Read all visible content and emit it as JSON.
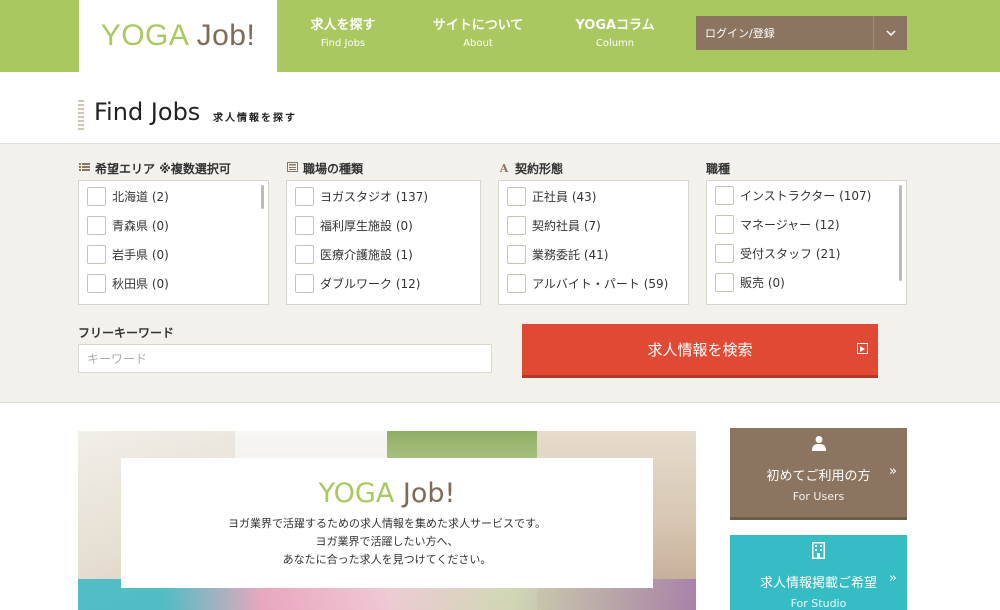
{
  "header": {
    "logo": {
      "part1": "YOGA",
      "part2": " Job!"
    },
    "nav": [
      {
        "jp": "求人を探す",
        "en": "Find Jobs"
      },
      {
        "jp": "サイトについて",
        "en": "About"
      },
      {
        "jp": "YOGAコラム",
        "en": "Column"
      }
    ],
    "login_label": "ログイン/登録"
  },
  "page_title": {
    "en": "Find Jobs",
    "jp": "求人情報を探す"
  },
  "search": {
    "groups": [
      {
        "label": "希望エリア ※複数選択可",
        "icon": "list-icon",
        "items": [
          "北海道 (2)",
          "青森県 (0)",
          "岩手県 (0)",
          "秋田県 (0)"
        ]
      },
      {
        "label": "職場の種類",
        "icon": "building-icon",
        "items": [
          "ヨガスタジオ (137)",
          "福利厚生施設 (0)",
          "医療介護施設 (1)",
          "ダブルワーク (12)"
        ]
      },
      {
        "label": "契約形態",
        "icon": "letter-a-icon",
        "items": [
          "正社員 (43)",
          "契約社員 (7)",
          "業務委託 (41)",
          "アルバイト・パート (59)"
        ]
      },
      {
        "label": "職種",
        "icon": "",
        "items": [
          "インストラクター (107)",
          "マネージャー (12)",
          "受付スタッフ (21)",
          "販売 (0)"
        ]
      }
    ],
    "keyword_label": "フリーキーワード",
    "keyword_placeholder": "キーワード",
    "keyword_value": "",
    "submit_label": "求人情報を検索"
  },
  "hero": {
    "logo": {
      "part1": "YOGA",
      "part2": " Job!"
    },
    "lines": [
      "ヨガ業界で活躍するための求人情報を集めた求人サービスです。",
      "ヨガ業界で活躍したい方へ、",
      "あなたに合った求人を見つけてください。"
    ]
  },
  "side": {
    "users": {
      "jp": "初めてご利用の方",
      "en": "For Users"
    },
    "studio": {
      "jp": "求人情報掲載ご希望",
      "en": "For Studio"
    }
  },
  "colors": {
    "brand_green": "#a9c85f",
    "brand_brown": "#8b7560",
    "search_red": "#e04a34",
    "studio_teal": "#35bcc4"
  }
}
